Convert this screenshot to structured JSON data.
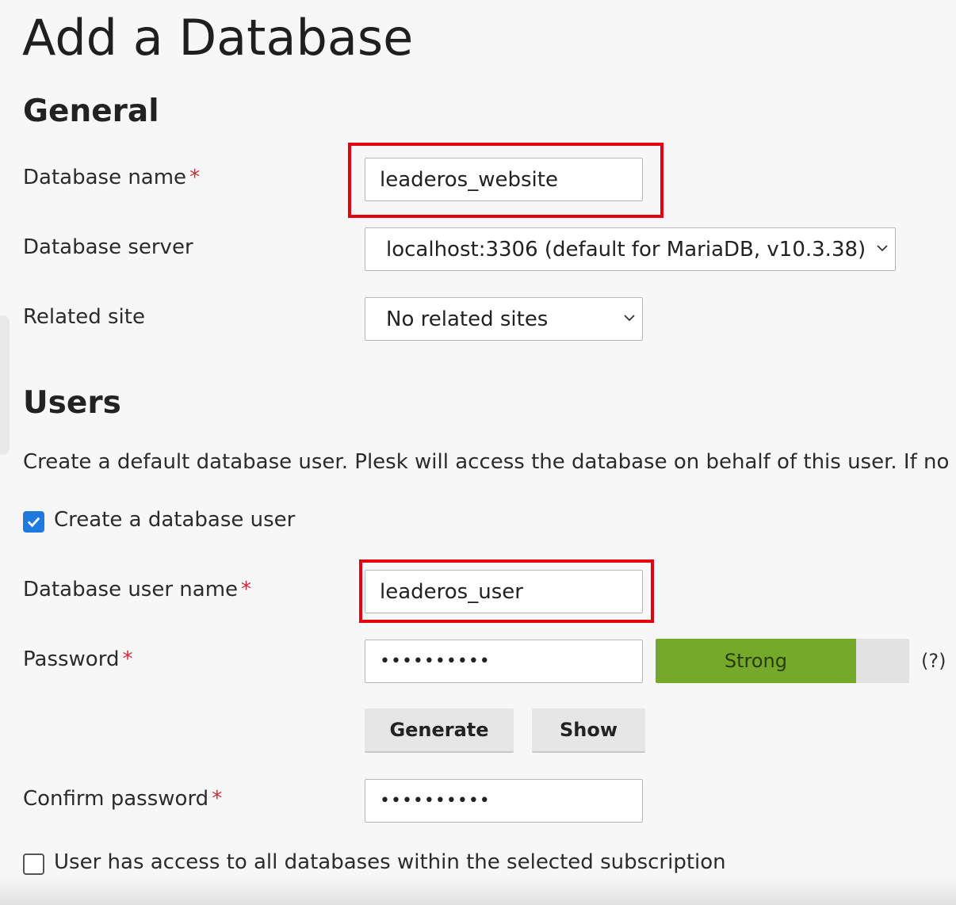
{
  "page": {
    "title": "Add a Database"
  },
  "general": {
    "heading": "General",
    "database_name": {
      "label": "Database name",
      "required_mark": "*",
      "value": "leaderos_website"
    },
    "database_server": {
      "label": "Database server",
      "selected": "localhost:3306 (default for MariaDB, v10.3.38)"
    },
    "related_site": {
      "label": "Related site",
      "selected": "No related sites"
    }
  },
  "users": {
    "heading": "Users",
    "description": "Create a default database user. Plesk will access the database on behalf of this user. If no d",
    "create_user_checkbox": {
      "label": "Create a database user",
      "checked": true
    },
    "user_name": {
      "label": "Database user name",
      "required_mark": "*",
      "value": "leaderos_user"
    },
    "password": {
      "label": "Password",
      "required_mark": "*",
      "masked_value": "••••••••••",
      "strength_label": "Strong",
      "strength_fraction": 0.79,
      "help": "(?)"
    },
    "buttons": {
      "generate": "Generate",
      "show": "Show"
    },
    "confirm_password": {
      "label": "Confirm password",
      "required_mark": "*",
      "masked_value": "••••••••••"
    },
    "all_databases_checkbox": {
      "label": "User has access to all databases within the selected subscription",
      "checked": false
    }
  },
  "colors": {
    "required": "#d02a3a",
    "highlight": "#e3000f",
    "strength_fill": "#75a92a",
    "checkbox_checked": "#1f7ae0"
  },
  "icons": {
    "select_arrow": "chevron-down-icon",
    "checkbox_check": "checkmark-icon"
  }
}
